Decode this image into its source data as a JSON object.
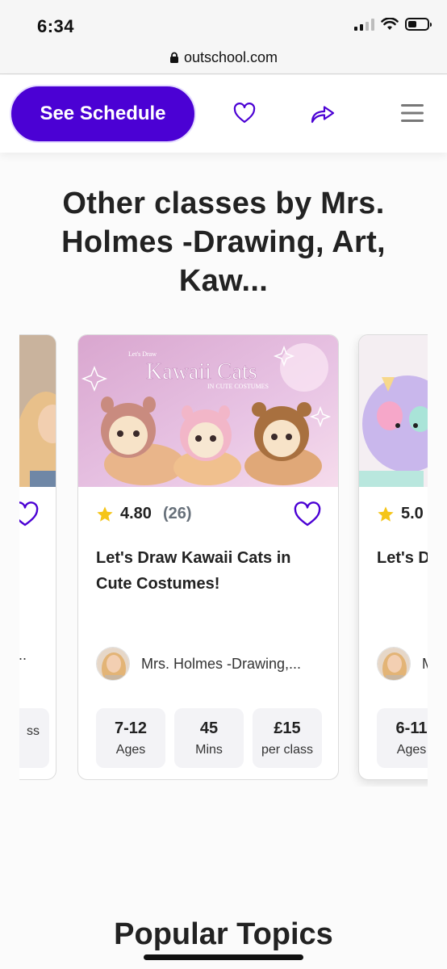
{
  "status_bar": {
    "time": "6:34"
  },
  "url_bar": {
    "url": "outschool.com",
    "lock_icon": "lock-icon"
  },
  "action_bar": {
    "schedule_label": "See Schedule",
    "icons": [
      "heart-outline-icon",
      "share-arrow-icon",
      "hamburger-menu-icon"
    ],
    "accent_color": "#4b01d4"
  },
  "section": {
    "title": "Other classes by Mrs. Holmes -Drawing, Art, Kaw..."
  },
  "cards": {
    "left": {
      "teacher": "..",
      "stats": [
        {
          "value": "",
          "label": "ss"
        }
      ]
    },
    "main": {
      "image_heading": "Let's Draw",
      "image_title": "Kawaii Cats",
      "image_subtitle": "IN CUTE COSTUMES",
      "rating": "4.80",
      "reviews": "(26)",
      "title": "Let's Draw Kawaii Cats in Cute Costumes!",
      "teacher": "Mrs. Holmes -Drawing,...",
      "stats": [
        {
          "value": "7-12",
          "label": "Ages"
        },
        {
          "value": "45",
          "label": "Mins"
        },
        {
          "value": "£15",
          "label": "per class"
        }
      ]
    },
    "right": {
      "rating": "5.0",
      "title": "Let's D",
      "teacher": "M",
      "stats": [
        {
          "value": "6-11",
          "label": "Ages"
        }
      ]
    }
  },
  "popular": {
    "title": "Popular Topics"
  },
  "colors": {
    "star": "#f5c518",
    "heart": "#4b01d4",
    "stat_bg": "#f3f3f6"
  }
}
